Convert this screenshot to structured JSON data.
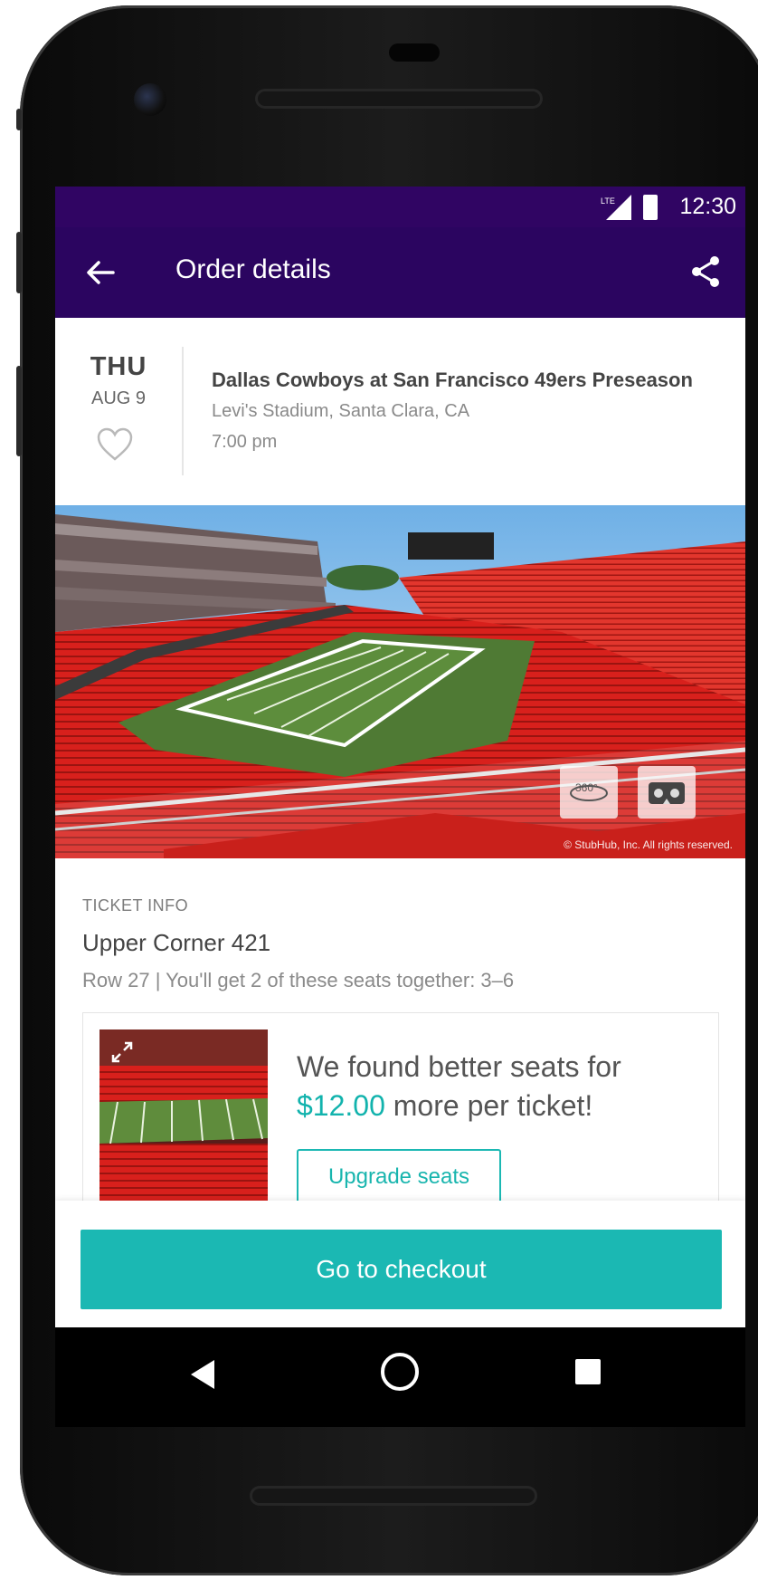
{
  "status_bar": {
    "network": "LTE",
    "time": "12:30"
  },
  "app_bar": {
    "title": "Order details"
  },
  "event": {
    "day_of_week": "THU",
    "date": "AUG 9",
    "title": "Dallas Cowboys at San Francisco 49ers Preseason",
    "venue": "Levi's Stadium, Santa Clara, CA",
    "time": "7:00 pm"
  },
  "stadium_view": {
    "copyright": "© StubHub, Inc. All rights reserved.",
    "btn_360_label": "360°"
  },
  "ticket_info": {
    "label": "TICKET INFO",
    "section": "Upper Corner 421",
    "row_details": "Row 27 | You'll get 2 of these seats together: 3–6"
  },
  "upgrade_card": {
    "text_before": "We found better seats for ",
    "price": "$12.00",
    "text_after": " more per ticket!",
    "button_label": "Upgrade seats"
  },
  "checkout": {
    "button_label": "Go to checkout"
  },
  "colors": {
    "status_bar": "#300563",
    "app_bar": "#2b0560",
    "accent": "#1bb8b3"
  },
  "icons": [
    "back-arrow-icon",
    "share-icon",
    "heart-icon",
    "360-view-icon",
    "vr-headset-icon",
    "expand-icon"
  ]
}
